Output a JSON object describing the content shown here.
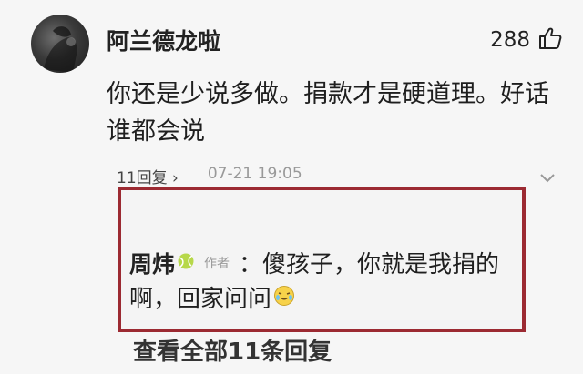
{
  "comment": {
    "username": "阿兰德龙啦",
    "likes": "288",
    "text": "你还是少说多做。捐款才是硬道理。好话谁都会说",
    "reply_count": "11回复 ›",
    "timestamp": "07-21 19:05"
  },
  "reply": {
    "name": "周炜",
    "author_tag": "作者",
    "text_line1": "：傻孩子，你就是我捐的",
    "text_line2": "啊，回家问问"
  },
  "view_all": "查看全部11条回复",
  "icons": {
    "like": "thumbs-up-icon",
    "badge": "tennis-ball-icon",
    "emoji": "laughing-crying-emoji-icon",
    "more": "chevron-down-icon"
  },
  "colors": {
    "highlight_border": "#9c2a32",
    "badge": "#b7d84a"
  }
}
